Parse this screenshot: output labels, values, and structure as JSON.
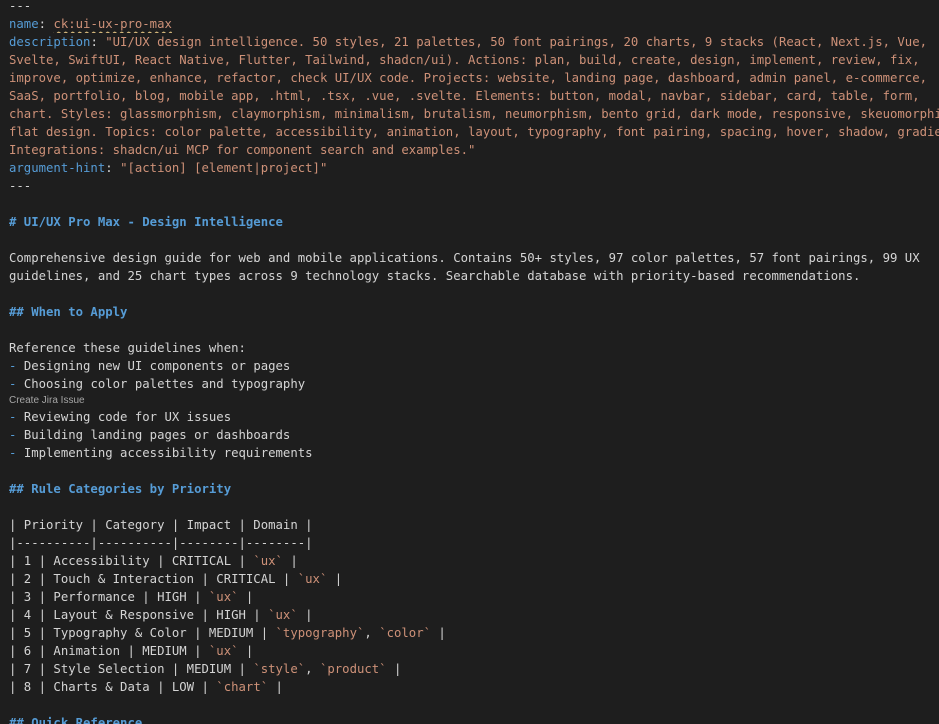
{
  "frontmatter": {
    "delimiter_open": "---",
    "name_key": "name",
    "name_value": "ck:ui-ux-pro-max",
    "description_key": "description",
    "description_lines": [
      "\"UI/UX design intelligence. 50 styles, 21 palettes, 50 font pairings, 20 charts, 9 stacks (React, Next.js, Vue,",
      "Svelte, SwiftUI, React Native, Flutter, Tailwind, shadcn/ui). Actions: plan, build, create, design, implement, review, fix,",
      "improve, optimize, enhance, refactor, check UI/UX code. Projects: website, landing page, dashboard, admin panel, e-commerce,",
      "SaaS, portfolio, blog, mobile app, .html, .tsx, .vue, .svelte. Elements: button, modal, navbar, sidebar, card, table, form,",
      "chart. Styles: glassmorphism, claymorphism, minimalism, brutalism, neumorphism, bento grid, dark mode, responsive, skeuomorphism,",
      "flat design. Topics: color palette, accessibility, animation, layout, typography, font pairing, spacing, hover, shadow, gradient.",
      "Integrations: shadcn/ui MCP for component search and examples.\""
    ],
    "hint_key": "argument-hint",
    "hint_value": "\"[action] [element|project]\"",
    "delimiter_close": "---"
  },
  "title": "# UI/UX Pro Max - Design Intelligence",
  "intro_lines": [
    "Comprehensive design guide for web and mobile applications. Contains 50+ styles, 97 color palettes, 57 font pairings, 99 UX",
    "guidelines, and 25 chart types across 9 technology stacks. Searchable database with priority-based recommendations."
  ],
  "when_heading": "## When to Apply",
  "when_intro": "Reference these guidelines when:",
  "bullet_marker": "-",
  "when_items": [
    "Designing new UI components or pages",
    "Choosing color palettes and typography",
    "Reviewing code for UX issues",
    "Building landing pages or dashboards",
    "Implementing accessibility requirements"
  ],
  "codelens_hint": "Create Jira Issue",
  "rules_heading": "## Rule Categories by Priority",
  "table_header": "| Priority | Category | Impact | Domain |",
  "table_separator": "|----------|----------|--------|--------|",
  "table_rows": [
    {
      "prefix": "| 1 | Accessibility | CRITICAL | ",
      "tags": [
        "`ux`"
      ],
      "suffix": " |"
    },
    {
      "prefix": "| 2 | Touch & Interaction | CRITICAL | ",
      "tags": [
        "`ux`"
      ],
      "suffix": " |"
    },
    {
      "prefix": "| 3 | Performance | HIGH | ",
      "tags": [
        "`ux`"
      ],
      "suffix": " |"
    },
    {
      "prefix": "| 4 | Layout & Responsive | HIGH | ",
      "tags": [
        "`ux`"
      ],
      "suffix": " |"
    },
    {
      "prefix": "| 5 | Typography & Color | MEDIUM | ",
      "tags": [
        "`typography`",
        "`color`"
      ],
      "suffix": " |"
    },
    {
      "prefix": "| 6 | Animation | MEDIUM | ",
      "tags": [
        "`ux`"
      ],
      "suffix": " |"
    },
    {
      "prefix": "| 7 | Style Selection | MEDIUM | ",
      "tags": [
        "`style`",
        "`product`"
      ],
      "suffix": " |"
    },
    {
      "prefix": "| 8 | Charts & Data | LOW | ",
      "tags": [
        "`chart`"
      ],
      "suffix": " |"
    }
  ],
  "next_heading": "## Quick Reference",
  "colors": {
    "background": "#1e1e1e",
    "text": "#d4d4d4",
    "keyword": "#569cd6",
    "string": "#ce9178",
    "squiggle": "#d7ba7d",
    "hint": "#a6a6a6"
  }
}
